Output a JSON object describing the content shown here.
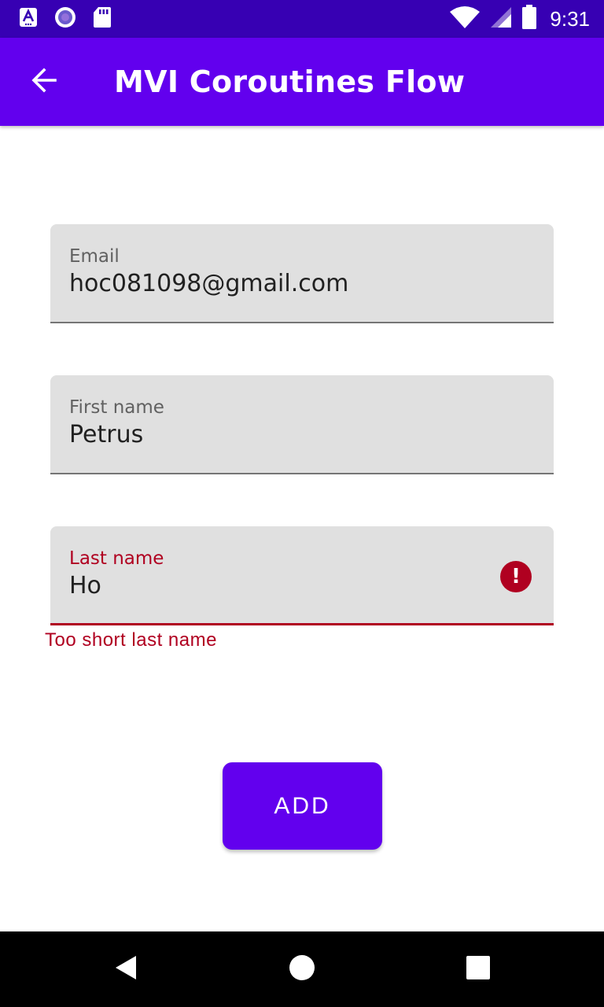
{
  "status_bar": {
    "time": "9:31",
    "background_color": "#3700b3",
    "left_icons": [
      "accessibility-icon",
      "record-icon",
      "sd-card-icon"
    ],
    "right_icons": [
      "wifi-icon",
      "signal-icon",
      "battery-icon"
    ]
  },
  "app_bar": {
    "title": "MVI Coroutines Flow",
    "background_color": "#6200ee",
    "back_icon": "arrow-back-icon"
  },
  "form": {
    "email": {
      "label": "Email",
      "value": "hoc081098@gmail.com"
    },
    "first_name": {
      "label": "First name",
      "value": "Petrus"
    },
    "last_name": {
      "label": "Last name",
      "value": "Ho",
      "error_icon": "error-icon",
      "error_message": "Too short last name",
      "error_color": "#b00020"
    }
  },
  "actions": {
    "add_label": "ADD",
    "button_color": "#6200ee"
  },
  "navigation_bar": {
    "buttons": [
      "back-triangle-icon",
      "home-circle-icon",
      "recents-square-icon"
    ]
  }
}
